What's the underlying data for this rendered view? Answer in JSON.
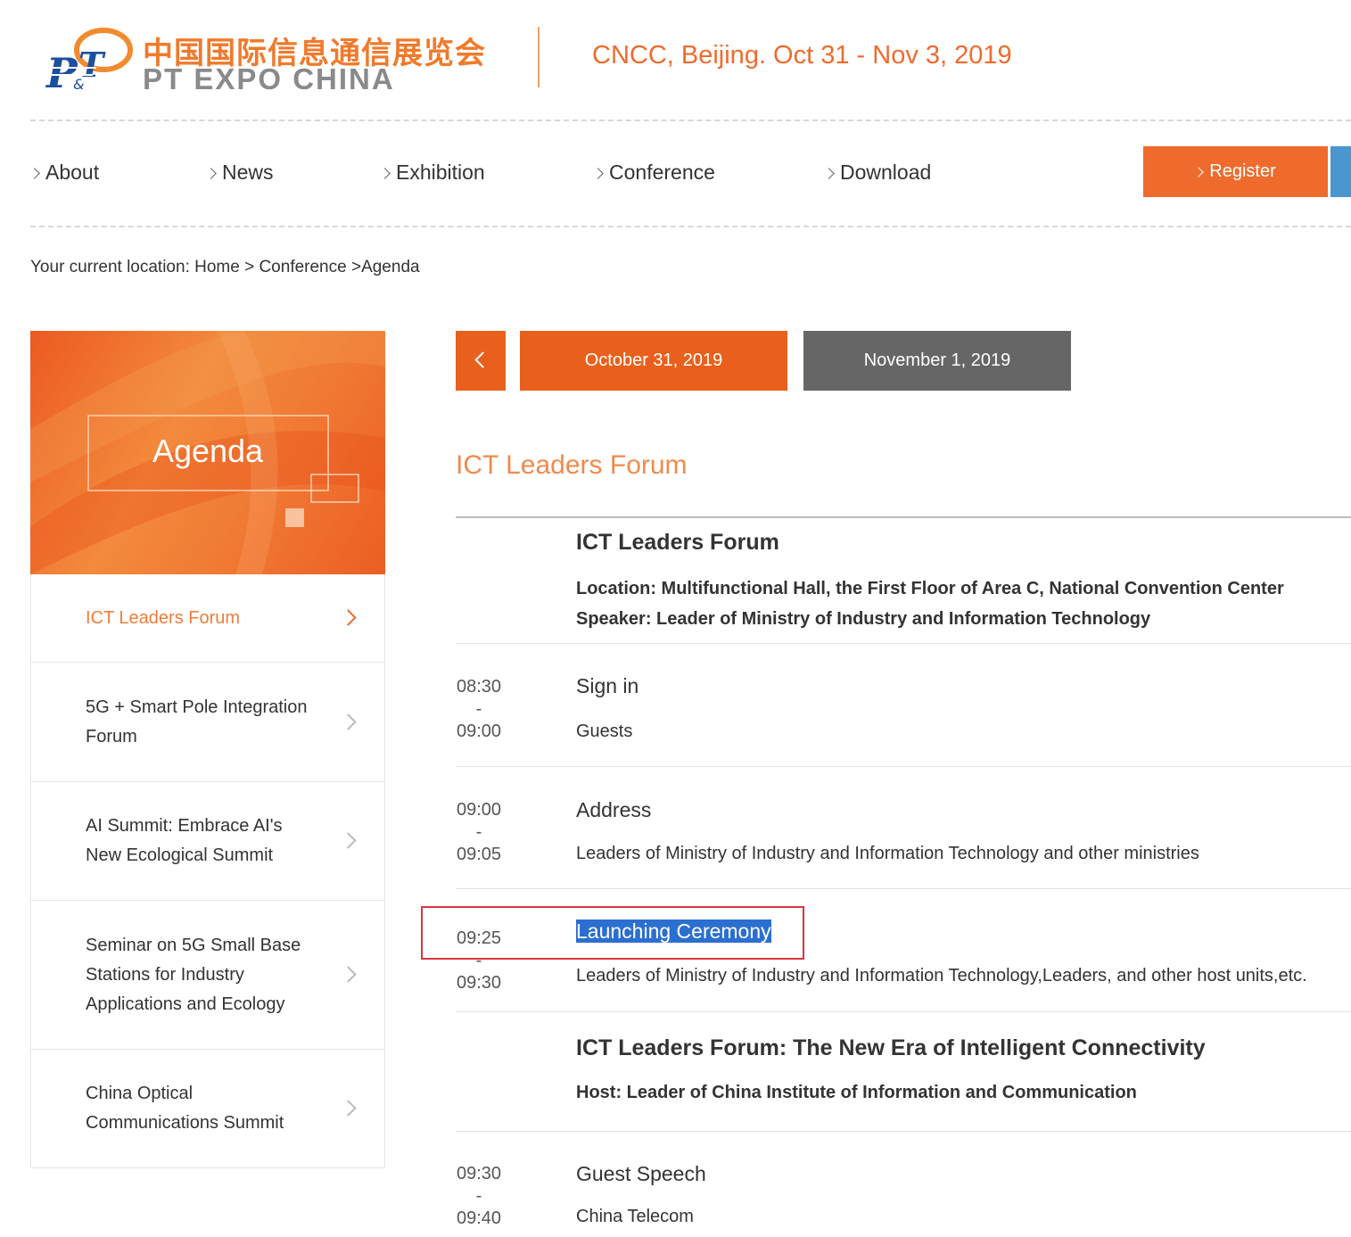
{
  "header": {
    "logo_cn": "中国国际信息通信展览会",
    "logo_en": "PT EXPO CHINA",
    "event": "CNCC, Beijing. Oct 31 - Nov 3, 2019"
  },
  "nav": {
    "items": [
      "About",
      "News",
      "Exhibition",
      "Conference",
      "Download"
    ],
    "register": "Register"
  },
  "breadcrumb": "Your current location:  Home > Conference >Agenda",
  "sidebar": {
    "banner_title": "Agenda",
    "items": [
      "ICT Leaders Forum",
      "5G + Smart Pole Integration Forum",
      "AI Summit: Embrace AI's New Ecological Summit",
      "Seminar on 5G Small Base Stations for Industry Applications and Ecology",
      "China Optical Communications Summit"
    ]
  },
  "dates": {
    "active": "October 31, 2019",
    "next": "November 1, 2019"
  },
  "forum_heading": "ICT Leaders Forum",
  "agenda": {
    "forum_title": "ICT Leaders Forum",
    "location": "Location:  Multifunctional Hall, the First Floor of Area C, National Convention Center",
    "speaker": "Speaker:  Leader of Ministry of Industry and Information Technology",
    "sessions": [
      {
        "start": "08:30",
        "sep": "-",
        "end": "09:00",
        "title": "Sign in",
        "sub": "Guests"
      },
      {
        "start": "09:00",
        "sep": "-",
        "end": "09:05",
        "title": "Address",
        "sub": "Leaders of Ministry of Industry and Information Technology and other ministries"
      },
      {
        "start": "09:25",
        "sep": "-",
        "end": "09:30",
        "title": "Launching Ceremony",
        "sub": "Leaders of Ministry of Industry and Information Technology,Leaders, and other host units,etc."
      }
    ],
    "subforum_title": "ICT Leaders Forum: The New Era of Intelligent Connectivity",
    "subforum_host": "Host: Leader of China Institute of Information and Communication",
    "session4": {
      "start": "09:30",
      "sep": "-",
      "end": "09:40",
      "title": "Guest Speech",
      "sub": "China Telecom"
    }
  }
}
